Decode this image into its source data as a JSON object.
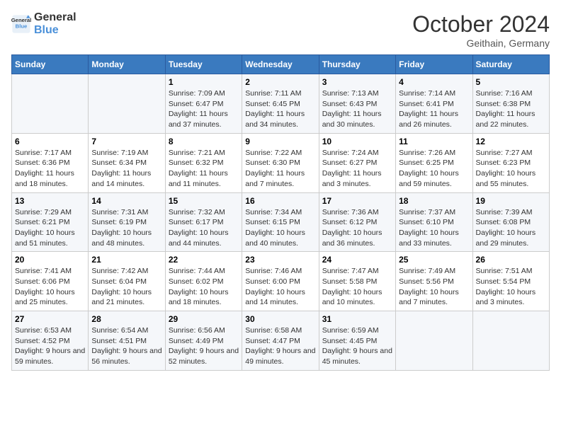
{
  "header": {
    "logo_line1": "General",
    "logo_line2": "Blue",
    "month": "October 2024",
    "location": "Geithain, Germany"
  },
  "days_of_week": [
    "Sunday",
    "Monday",
    "Tuesday",
    "Wednesday",
    "Thursday",
    "Friday",
    "Saturday"
  ],
  "weeks": [
    [
      {
        "day": "",
        "detail": ""
      },
      {
        "day": "",
        "detail": ""
      },
      {
        "day": "1",
        "detail": "Sunrise: 7:09 AM\nSunset: 6:47 PM\nDaylight: 11 hours and 37 minutes."
      },
      {
        "day": "2",
        "detail": "Sunrise: 7:11 AM\nSunset: 6:45 PM\nDaylight: 11 hours and 34 minutes."
      },
      {
        "day": "3",
        "detail": "Sunrise: 7:13 AM\nSunset: 6:43 PM\nDaylight: 11 hours and 30 minutes."
      },
      {
        "day": "4",
        "detail": "Sunrise: 7:14 AM\nSunset: 6:41 PM\nDaylight: 11 hours and 26 minutes."
      },
      {
        "day": "5",
        "detail": "Sunrise: 7:16 AM\nSunset: 6:38 PM\nDaylight: 11 hours and 22 minutes."
      }
    ],
    [
      {
        "day": "6",
        "detail": "Sunrise: 7:17 AM\nSunset: 6:36 PM\nDaylight: 11 hours and 18 minutes."
      },
      {
        "day": "7",
        "detail": "Sunrise: 7:19 AM\nSunset: 6:34 PM\nDaylight: 11 hours and 14 minutes."
      },
      {
        "day": "8",
        "detail": "Sunrise: 7:21 AM\nSunset: 6:32 PM\nDaylight: 11 hours and 11 minutes."
      },
      {
        "day": "9",
        "detail": "Sunrise: 7:22 AM\nSunset: 6:30 PM\nDaylight: 11 hours and 7 minutes."
      },
      {
        "day": "10",
        "detail": "Sunrise: 7:24 AM\nSunset: 6:27 PM\nDaylight: 11 hours and 3 minutes."
      },
      {
        "day": "11",
        "detail": "Sunrise: 7:26 AM\nSunset: 6:25 PM\nDaylight: 10 hours and 59 minutes."
      },
      {
        "day": "12",
        "detail": "Sunrise: 7:27 AM\nSunset: 6:23 PM\nDaylight: 10 hours and 55 minutes."
      }
    ],
    [
      {
        "day": "13",
        "detail": "Sunrise: 7:29 AM\nSunset: 6:21 PM\nDaylight: 10 hours and 51 minutes."
      },
      {
        "day": "14",
        "detail": "Sunrise: 7:31 AM\nSunset: 6:19 PM\nDaylight: 10 hours and 48 minutes."
      },
      {
        "day": "15",
        "detail": "Sunrise: 7:32 AM\nSunset: 6:17 PM\nDaylight: 10 hours and 44 minutes."
      },
      {
        "day": "16",
        "detail": "Sunrise: 7:34 AM\nSunset: 6:15 PM\nDaylight: 10 hours and 40 minutes."
      },
      {
        "day": "17",
        "detail": "Sunrise: 7:36 AM\nSunset: 6:12 PM\nDaylight: 10 hours and 36 minutes."
      },
      {
        "day": "18",
        "detail": "Sunrise: 7:37 AM\nSunset: 6:10 PM\nDaylight: 10 hours and 33 minutes."
      },
      {
        "day": "19",
        "detail": "Sunrise: 7:39 AM\nSunset: 6:08 PM\nDaylight: 10 hours and 29 minutes."
      }
    ],
    [
      {
        "day": "20",
        "detail": "Sunrise: 7:41 AM\nSunset: 6:06 PM\nDaylight: 10 hours and 25 minutes."
      },
      {
        "day": "21",
        "detail": "Sunrise: 7:42 AM\nSunset: 6:04 PM\nDaylight: 10 hours and 21 minutes."
      },
      {
        "day": "22",
        "detail": "Sunrise: 7:44 AM\nSunset: 6:02 PM\nDaylight: 10 hours and 18 minutes."
      },
      {
        "day": "23",
        "detail": "Sunrise: 7:46 AM\nSunset: 6:00 PM\nDaylight: 10 hours and 14 minutes."
      },
      {
        "day": "24",
        "detail": "Sunrise: 7:47 AM\nSunset: 5:58 PM\nDaylight: 10 hours and 10 minutes."
      },
      {
        "day": "25",
        "detail": "Sunrise: 7:49 AM\nSunset: 5:56 PM\nDaylight: 10 hours and 7 minutes."
      },
      {
        "day": "26",
        "detail": "Sunrise: 7:51 AM\nSunset: 5:54 PM\nDaylight: 10 hours and 3 minutes."
      }
    ],
    [
      {
        "day": "27",
        "detail": "Sunrise: 6:53 AM\nSunset: 4:52 PM\nDaylight: 9 hours and 59 minutes."
      },
      {
        "day": "28",
        "detail": "Sunrise: 6:54 AM\nSunset: 4:51 PM\nDaylight: 9 hours and 56 minutes."
      },
      {
        "day": "29",
        "detail": "Sunrise: 6:56 AM\nSunset: 4:49 PM\nDaylight: 9 hours and 52 minutes."
      },
      {
        "day": "30",
        "detail": "Sunrise: 6:58 AM\nSunset: 4:47 PM\nDaylight: 9 hours and 49 minutes."
      },
      {
        "day": "31",
        "detail": "Sunrise: 6:59 AM\nSunset: 4:45 PM\nDaylight: 9 hours and 45 minutes."
      },
      {
        "day": "",
        "detail": ""
      },
      {
        "day": "",
        "detail": ""
      }
    ]
  ]
}
